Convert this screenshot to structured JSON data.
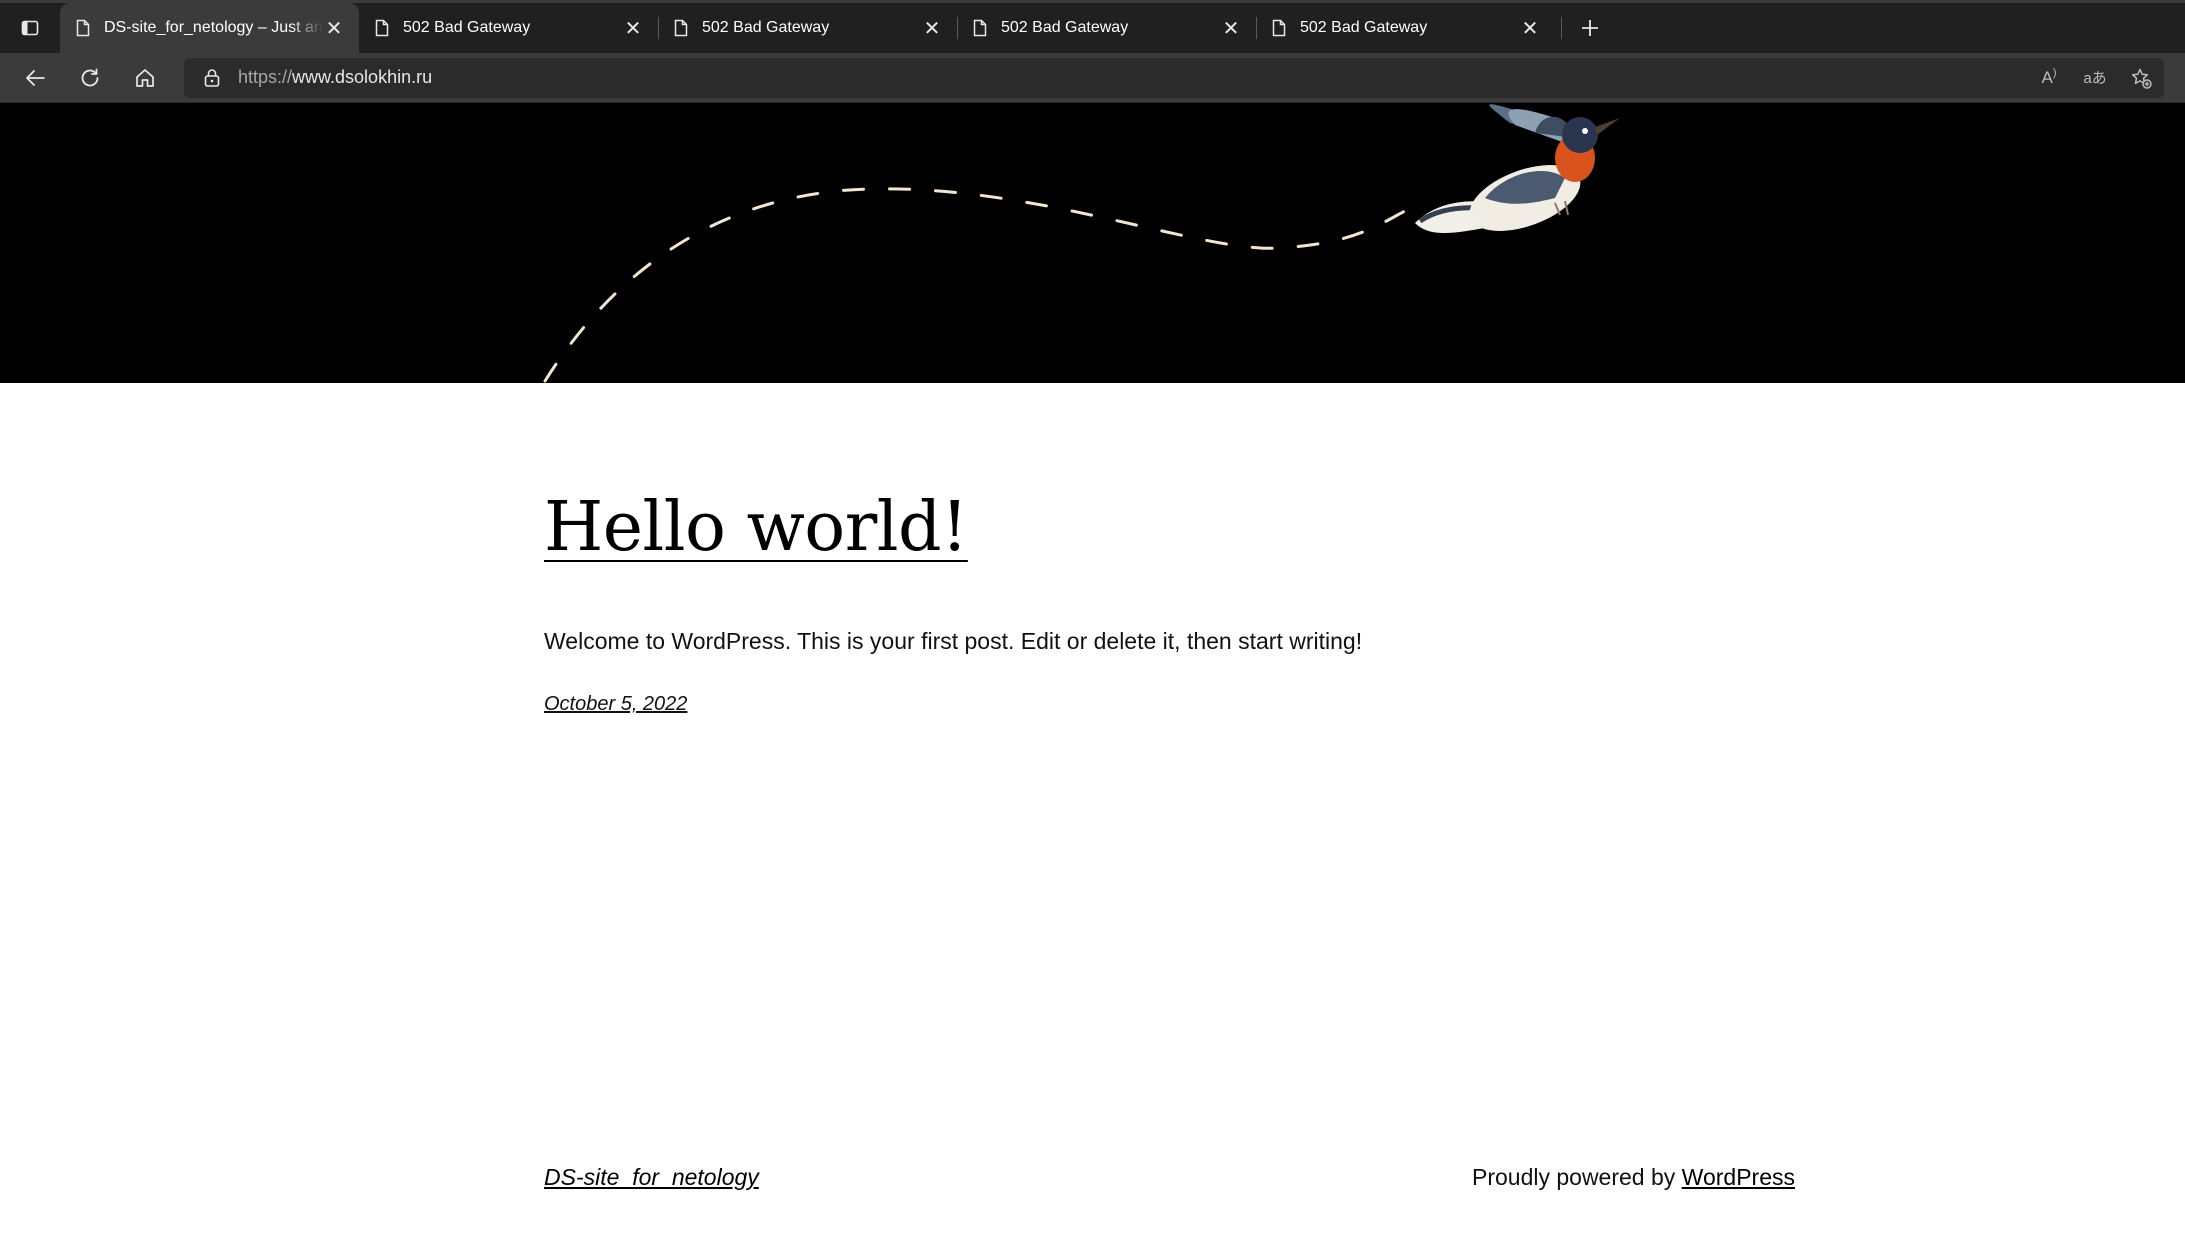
{
  "browser": {
    "tabs": [
      {
        "label": "DS-site_for_netology – Just another WordPress site",
        "active": true
      },
      {
        "label": "502 Bad Gateway",
        "active": false
      },
      {
        "label": "502 Bad Gateway",
        "active": false
      },
      {
        "label": "502 Bad Gateway",
        "active": false
      },
      {
        "label": "502 Bad Gateway",
        "active": false
      }
    ],
    "icons": {
      "tab_actions": "tab-actions-icon",
      "tab_page": "page-icon",
      "tab_close": "close-icon",
      "new_tab": "plus-icon",
      "back": "back-arrow-icon",
      "reload": "reload-icon",
      "home": "home-icon",
      "lock": "lock-icon",
      "read_aloud": "read-aloud-icon",
      "translate": "translate-icon",
      "favorites": "add-favorite-icon"
    },
    "address": {
      "scheme": "https://",
      "host": "www.dsolokhin.ru"
    },
    "read_aloud_glyph": "A",
    "translate_glyph": "aあ"
  },
  "page": {
    "colors": {
      "hero_bg": "#000000",
      "path_dash": "#f3e6d1",
      "bird_breast": "#d9531e"
    },
    "post": {
      "title": "Hello world!",
      "excerpt": "Welcome to WordPress. This is your first post. Edit or delete it, then start writing!",
      "date": "October 5, 2022"
    },
    "footer": {
      "site_title": "DS-site_for_netology",
      "credit_prefix": "Proudly powered by ",
      "credit_link": "WordPress"
    }
  }
}
